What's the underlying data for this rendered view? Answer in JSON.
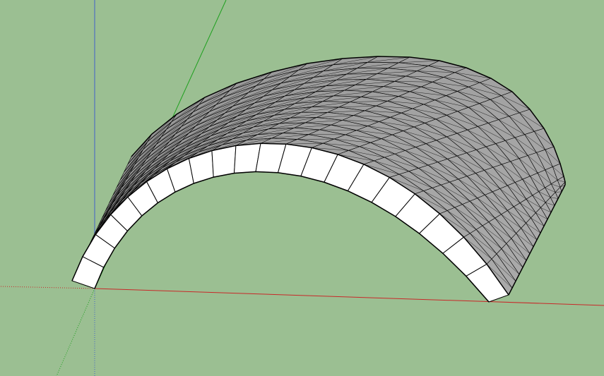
{
  "viewport": {
    "background_color": "#9bbf92"
  },
  "axes": {
    "red_axis_color": "#c82828",
    "green_axis_color": "#1ea01e",
    "blue_axis_color": "#4060c8"
  },
  "model": {
    "type": "barrel-vault-arch",
    "face_color": "#ffffff",
    "surface_color": "#9a9a9a",
    "edge_color": "#000000",
    "front_segments": 20,
    "depth_segments": 16
  }
}
